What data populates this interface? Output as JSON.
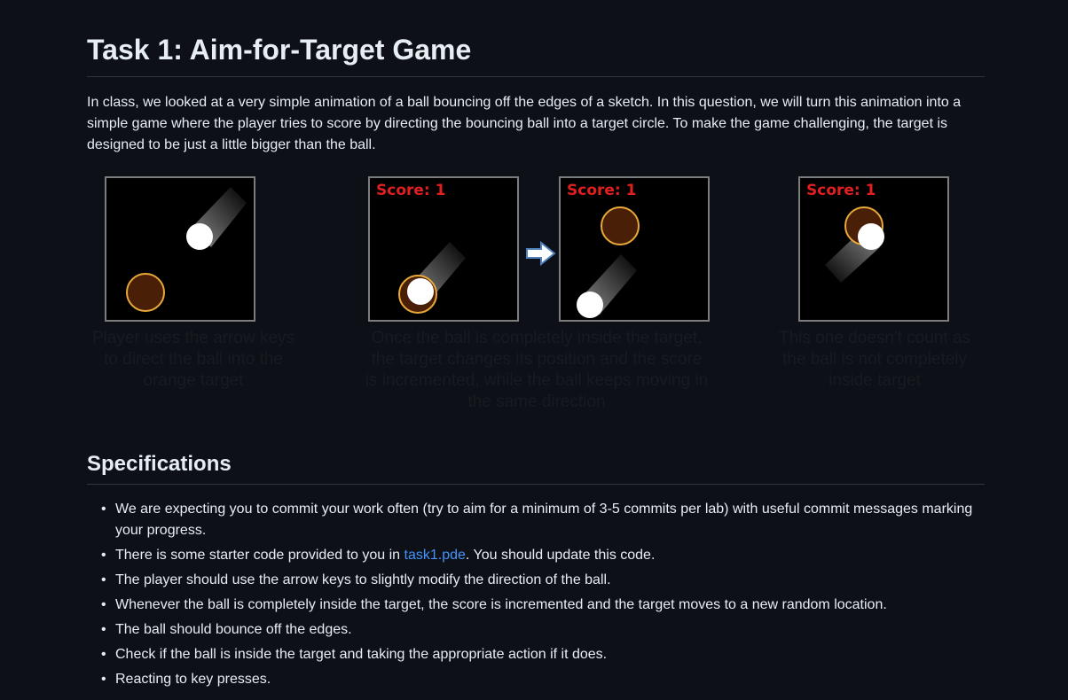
{
  "heading": "Task 1: Aim-for-Target Game",
  "intro": "In class, we looked at a very simple animation of a ball bouncing off the edges of a sketch. In this question, we will turn this animation into a simple game where the player tries to score by directing the bouncing ball into a target circle. To make the game challenging, the target is designed to be just a little bigger than the ball.",
  "figure": {
    "score_label": "Score: 1",
    "captions": [
      "Player uses the arrow keys to direct the ball into the orange target",
      "Once the ball is completely inside the target, the target changes its position and the score is incremented, while the ball keeps moving in the same direction",
      "This one doesn't count as the ball is not completely inside target"
    ],
    "colors": {
      "target_fill": "#4a1f08",
      "target_ring": "#e8a93a",
      "ball": "#ffffff",
      "score": "#e02020"
    }
  },
  "specs_heading": "Specifications",
  "specs": {
    "item1": "We are expecting you to commit your work often (try to aim for a minimum of 3-5 commits per lab) with useful commit messages marking your progress.",
    "item2_before": "There is some starter code provided to you in ",
    "item2_link": "task1.pde",
    "item2_after": ". You should update this code.",
    "item3": "The player should use the arrow keys to slightly modify the direction of the ball.",
    "item4": "Whenever the ball is completely inside the target, the score is incremented and the target moves to a new random location.",
    "item5": "The ball should bounce off the edges.",
    "item6": "Check if the ball is inside the target and taking the appropriate action if it does.",
    "item7": "Reacting to key presses."
  }
}
